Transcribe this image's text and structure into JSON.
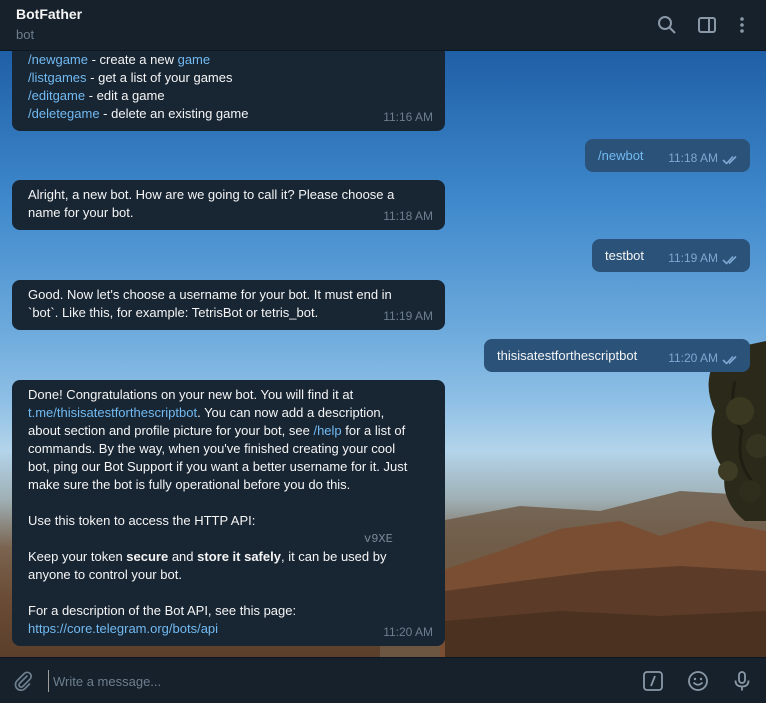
{
  "header": {
    "title": "BotFather",
    "subtitle": "bot",
    "icons": [
      "search-icon",
      "sidebar-toggle-icon",
      "more-vertical-icon"
    ]
  },
  "messages": {
    "m1": {
      "lines": [
        {
          "cmd": "/newgame",
          "text": " - create a new ",
          "link": "game"
        },
        {
          "cmd": "/listgames",
          "text": " - get a list of your games"
        },
        {
          "cmd": "/editgame",
          "text": " - edit a game"
        },
        {
          "cmd": "/deletegame",
          "text": " - delete an existing game"
        }
      ],
      "time": "11:16 AM"
    },
    "m2": {
      "text": "/newbot",
      "time": "11:18 AM"
    },
    "m3": {
      "line1": "Alright, a new bot. How are we going to call it? Please choose a",
      "line2": "name for your bot.",
      "time": "11:18 AM"
    },
    "m4": {
      "text": "testbot",
      "time": "11:19 AM"
    },
    "m5": {
      "line1": "Good. Now let's choose a username for your bot. It must end in",
      "line2": "`bot`. Like this, for example: TetrisBot or tetris_bot.",
      "time": "11:19 AM"
    },
    "m6": {
      "text": "thisisatestforthescriptbot",
      "time": "11:20 AM"
    },
    "m7": {
      "p1_line1": "Done! Congratulations on your new bot. You will find it at",
      "p1_link": "t.me/thisisatestforthescriptbot",
      "p1_line2_rest": ". You can now add a description,",
      "p1_line3": "about section and profile picture for your bot, see ",
      "p1_help": "/help",
      "p1_line3_rest": " for a list of",
      "p1_line4": "commands. By the way, when you've finished creating your cool",
      "p1_line5": "bot, ping our Bot Support if you want a better username for it. Just",
      "p1_line6": "make sure the bot is fully operational before you do this.",
      "p2": "Use this token to access the HTTP API:",
      "token": "v9XE",
      "p3_a": "Keep your token ",
      "p3_b": "secure",
      "p3_c": " and ",
      "p3_d": "store it safely",
      "p3_e": ", it can be used by",
      "p3_line2": "anyone to control your bot.",
      "p4": "For a description of the Bot API, see this page:",
      "p4_link": "https://core.telegram.org/bots/api",
      "time": "11:20 AM"
    }
  },
  "composer": {
    "placeholder": "Write a message...",
    "icons": [
      "attach-icon",
      "commands-icon",
      "emoji-icon",
      "microphone-icon"
    ]
  },
  "colors": {
    "background": "#17212b",
    "incoming_bubble": "#182533",
    "outgoing_bubble": "#2b5278",
    "link": "#71baf2",
    "muted": "#6d7f8f"
  }
}
